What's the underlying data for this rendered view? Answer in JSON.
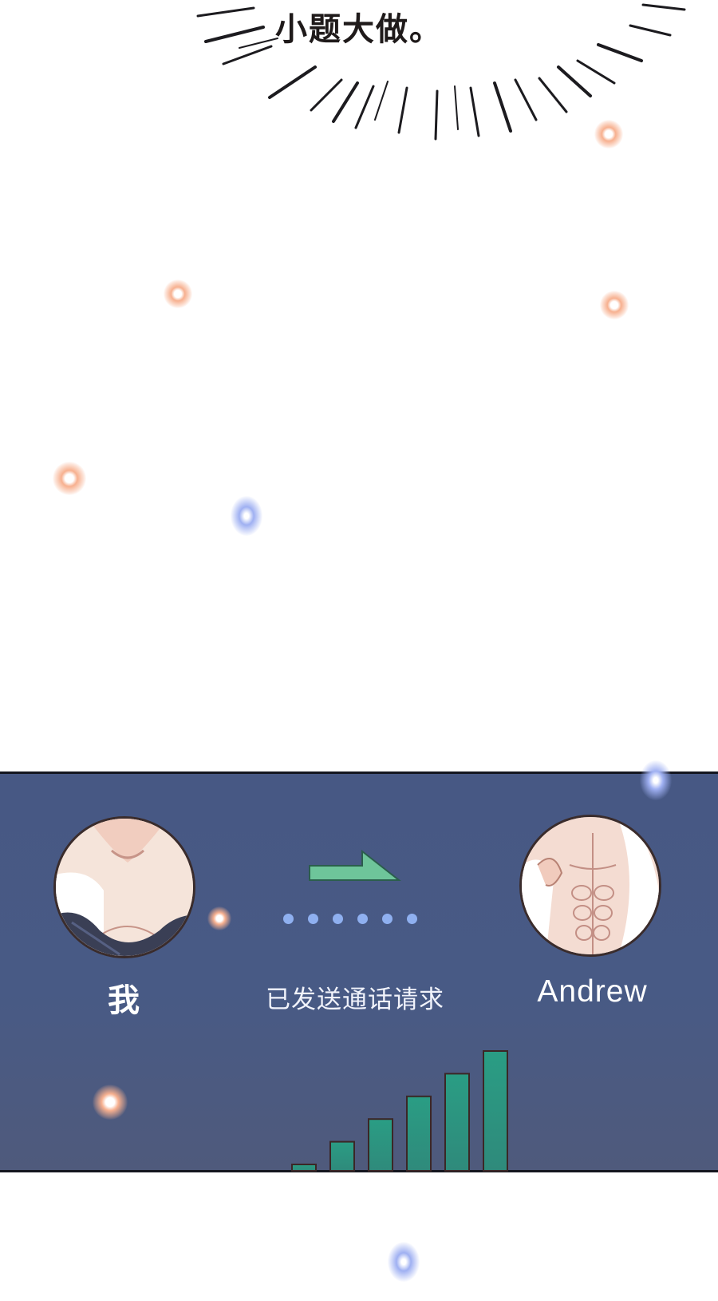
{
  "caption": {
    "text": "小题大做。"
  },
  "call_panel": {
    "caller": {
      "name": "我"
    },
    "status": "已发送通话请求",
    "callee": {
      "name": "Andrew"
    },
    "arrow_icon": "arrow-right-icon",
    "signal_icon": "signal-strength-icon",
    "signal_bars": 6
  },
  "colors": {
    "panel_background": "#475884",
    "arrow": "#6ec59a",
    "signal_bars": "#2d9a82",
    "dots": "#8fb0f0",
    "warm_glow": "#f7b08f",
    "cool_glow": "#9fb0f2"
  }
}
